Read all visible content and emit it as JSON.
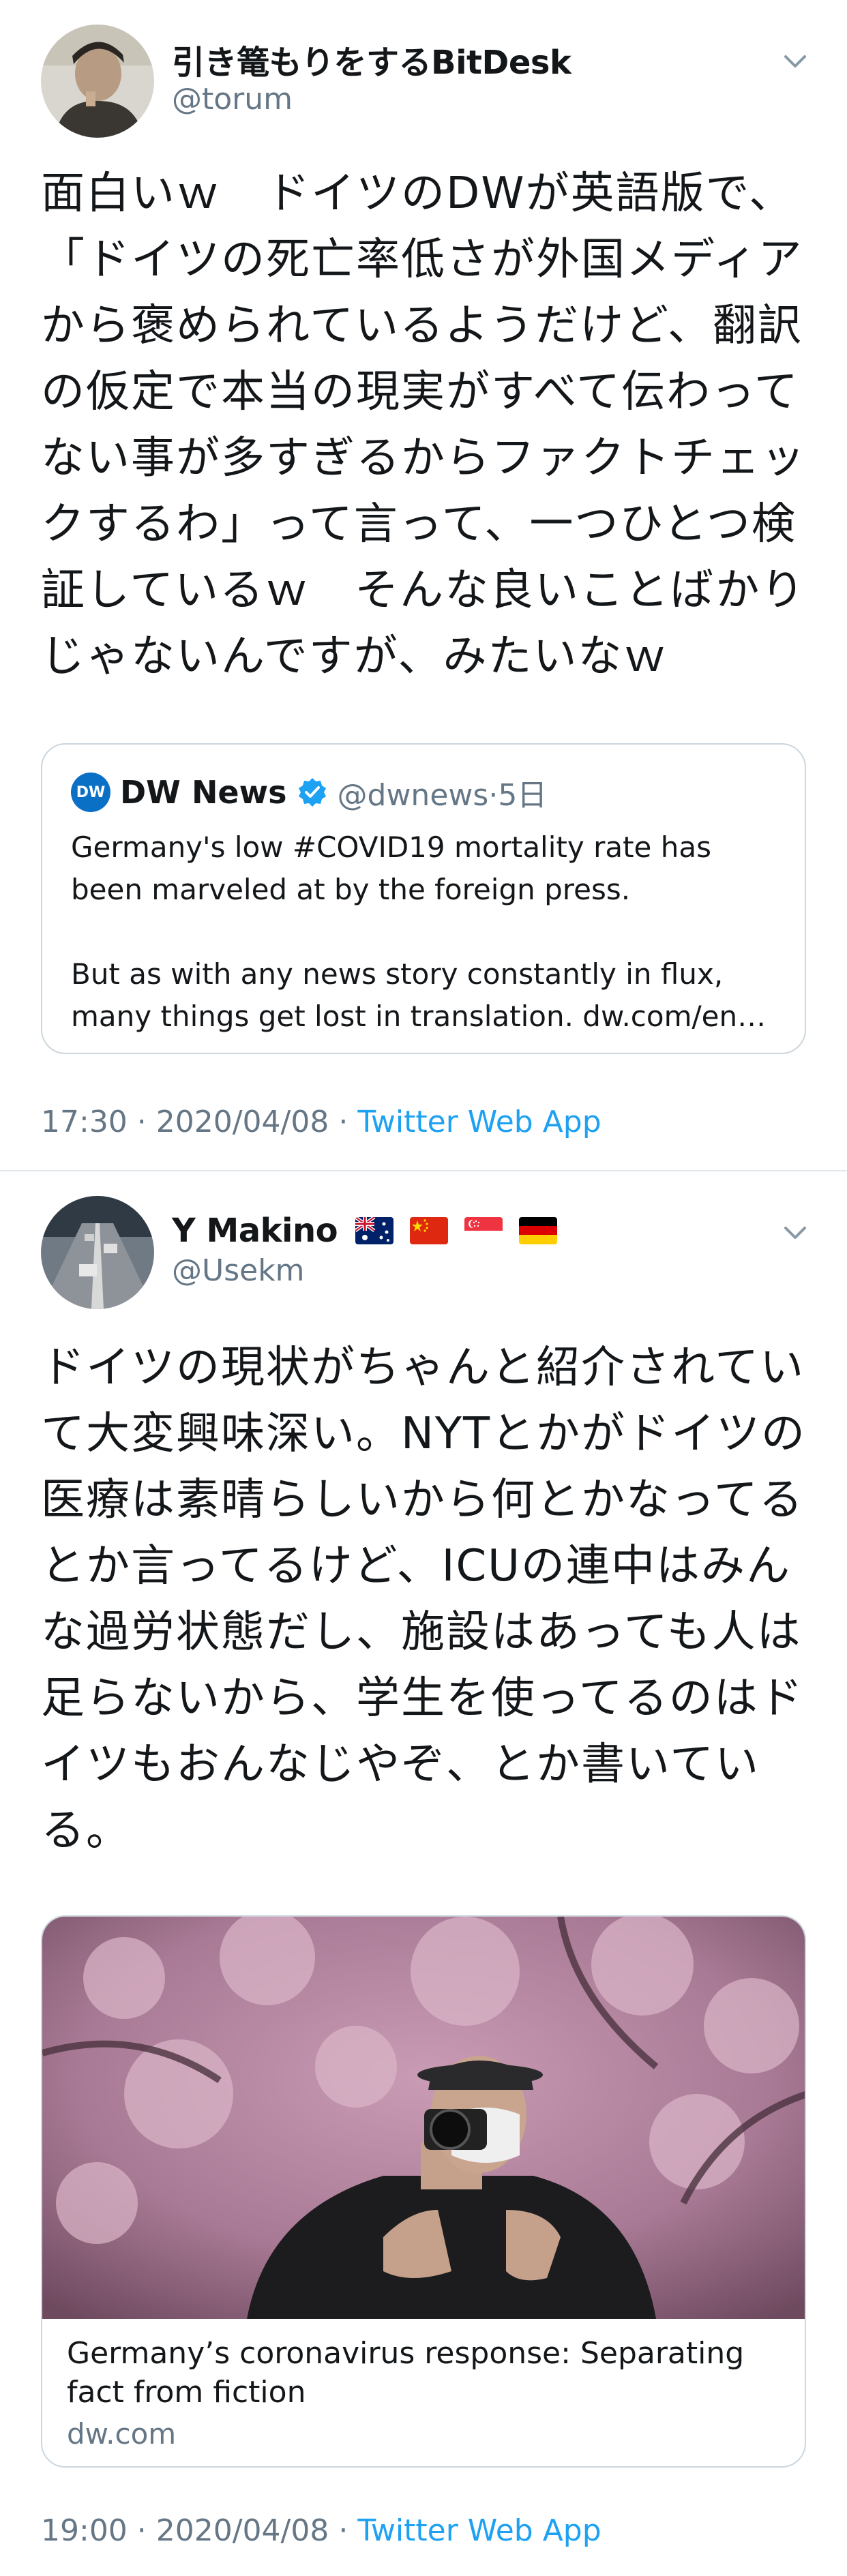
{
  "tweets": [
    {
      "author": {
        "name": "引き篭もりをするBitDesk",
        "handle": "@torum"
      },
      "body": "面白いｗ　ドイツのDWが英語版で、\n「ドイツの死亡率低さが外国メディア\nから褒められているようだけど、翻訳\nの仮定で本当の現実がすべて伝わって\nない事が多すぎるからファクトチェッ\nクするわ」って言って、一つひとつ検\n証しているｗ　そんな良いことばかり\nじゃないんですが、みたいなｗ",
      "quote": {
        "logo_text": "DW",
        "name": "DW News",
        "handle": "@dwnews",
        "age": "5日",
        "line1": "Germany's low #COVID19 mortality rate has",
        "line2": "been marveled at by the foreign press.",
        "line3": "But as with any news story constantly in flux,",
        "line4": "many things get lost in translation. dw.com/en…"
      },
      "time": "17:30 · 2020/04/08 · ",
      "app": "Twitter Web App"
    },
    {
      "author": {
        "name": "Y Makino",
        "handle": "@Usekm"
      },
      "flags": [
        "australia-flag",
        "china-flag",
        "singapore-flag",
        "germany-flag"
      ],
      "body": "ドイツの現状がちゃんと紹介されてい\nて大変興味深い。NYTとかがドイツの\n医療は素晴らしいから何とかなってる\nとか言ってるけど、ICUの連中はみん\nな過労状態だし、施設はあっても人は\n足らないから、学生を使ってるのはド\nイツもおんなじやぞ、とか書いてい\nる。",
      "card": {
        "title": "Germany’s coronavirus response: Separating fact from fiction",
        "domain": "dw.com"
      },
      "time": "19:00 · 2020/04/08 · ",
      "app": "Twitter Web App"
    }
  ],
  "colors": {
    "link": "#1da1f2",
    "secondary": "#657786",
    "border": "#ccd6dd"
  }
}
